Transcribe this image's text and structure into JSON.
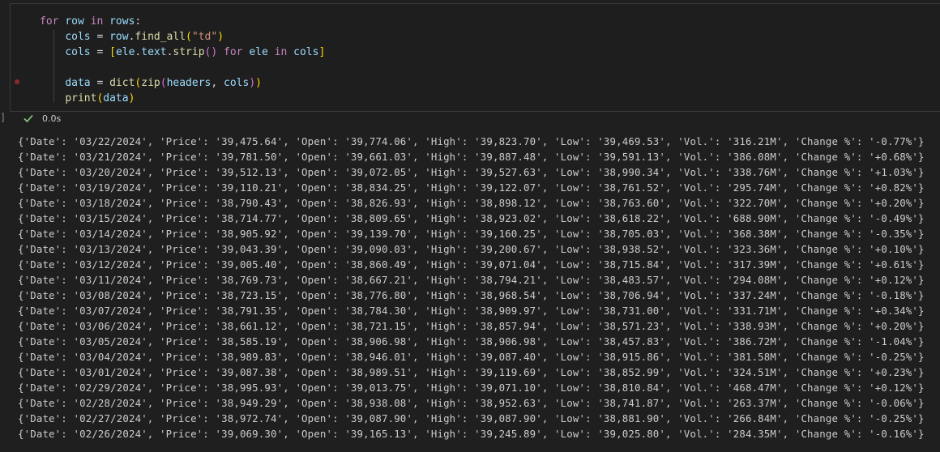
{
  "cell": {
    "code_lines": [
      "for row in rows:",
      "    cols = row.find_all(\"td\")",
      "    cols = [ele.text.strip() for ele in cols]",
      "",
      "    data = dict(zip(headers, cols))",
      "    print(data)"
    ],
    "gutter_bracket": "]",
    "exec_time": "0.0s"
  },
  "output": {
    "lines": [
      "{'Date': '03/22/2024', 'Price': '39,475.64', 'Open': '39,774.06', 'High': '39,823.70', 'Low': '39,469.53', 'Vol.': '316.21M', 'Change %': '-0.77%'}",
      "{'Date': '03/21/2024', 'Price': '39,781.50', 'Open': '39,661.03', 'High': '39,887.48', 'Low': '39,591.13', 'Vol.': '386.08M', 'Change %': '+0.68%'}",
      "{'Date': '03/20/2024', 'Price': '39,512.13', 'Open': '39,072.05', 'High': '39,527.63', 'Low': '38,990.34', 'Vol.': '338.76M', 'Change %': '+1.03%'}",
      "{'Date': '03/19/2024', 'Price': '39,110.21', 'Open': '38,834.25', 'High': '39,122.07', 'Low': '38,761.52', 'Vol.': '295.74M', 'Change %': '+0.82%'}",
      "{'Date': '03/18/2024', 'Price': '38,790.43', 'Open': '38,826.93', 'High': '38,898.12', 'Low': '38,763.60', 'Vol.': '322.70M', 'Change %': '+0.20%'}",
      "{'Date': '03/15/2024', 'Price': '38,714.77', 'Open': '38,809.65', 'High': '38,923.02', 'Low': '38,618.22', 'Vol.': '688.90M', 'Change %': '-0.49%'}",
      "{'Date': '03/14/2024', 'Price': '38,905.92', 'Open': '39,139.70', 'High': '39,160.25', 'Low': '38,705.03', 'Vol.': '368.38M', 'Change %': '-0.35%'}",
      "{'Date': '03/13/2024', 'Price': '39,043.39', 'Open': '39,090.03', 'High': '39,200.67', 'Low': '38,938.52', 'Vol.': '323.36M', 'Change %': '+0.10%'}",
      "{'Date': '03/12/2024', 'Price': '39,005.40', 'Open': '38,860.49', 'High': '39,071.04', 'Low': '38,715.84', 'Vol.': '317.39M', 'Change %': '+0.61%'}",
      "{'Date': '03/11/2024', 'Price': '38,769.73', 'Open': '38,667.21', 'High': '38,794.21', 'Low': '38,483.57', 'Vol.': '294.08M', 'Change %': '+0.12%'}",
      "{'Date': '03/08/2024', 'Price': '38,723.15', 'Open': '38,776.80', 'High': '38,968.54', 'Low': '38,706.94', 'Vol.': '337.24M', 'Change %': '-0.18%'}",
      "{'Date': '03/07/2024', 'Price': '38,791.35', 'Open': '38,784.30', 'High': '38,909.97', 'Low': '38,731.00', 'Vol.': '331.71M', 'Change %': '+0.34%'}",
      "{'Date': '03/06/2024', 'Price': '38,661.12', 'Open': '38,721.15', 'High': '38,857.94', 'Low': '38,571.23', 'Vol.': '338.93M', 'Change %': '+0.20%'}",
      "{'Date': '03/05/2024', 'Price': '38,585.19', 'Open': '38,906.98', 'High': '38,906.98', 'Low': '38,457.83', 'Vol.': '386.72M', 'Change %': '-1.04%'}",
      "{'Date': '03/04/2024', 'Price': '38,989.83', 'Open': '38,946.01', 'High': '39,087.40', 'Low': '38,915.86', 'Vol.': '381.58M', 'Change %': '-0.25%'}",
      "{'Date': '03/01/2024', 'Price': '39,087.38', 'Open': '38,989.51', 'High': '39,119.69', 'Low': '38,852.99', 'Vol.': '324.51M', 'Change %': '+0.23%'}",
      "{'Date': '02/29/2024', 'Price': '38,995.93', 'Open': '39,013.75', 'High': '39,071.10', 'Low': '38,810.84', 'Vol.': '468.47M', 'Change %': '+0.12%'}",
      "{'Date': '02/28/2024', 'Price': '38,949.29', 'Open': '38,938.08', 'High': '38,952.63', 'Low': '38,741.87', 'Vol.': '263.37M', 'Change %': '-0.06%'}",
      "{'Date': '02/27/2024', 'Price': '38,972.74', 'Open': '39,087.90', 'High': '39,087.90', 'Low': '38,881.90', 'Vol.': '266.84M', 'Change %': '-0.25%'}",
      "{'Date': '02/26/2024', 'Price': '39,069.30', 'Open': '39,165.13', 'High': '39,245.89', 'Low': '39,025.80', 'Vol.': '284.35M', 'Change %': '-0.16%'}"
    ]
  },
  "colors": {
    "background": "#1f1f1f",
    "keyword": "#c586c0",
    "variable": "#9cdcfe",
    "function": "#dcdcaa",
    "string": "#ce9178",
    "success_check": "#89d185"
  }
}
